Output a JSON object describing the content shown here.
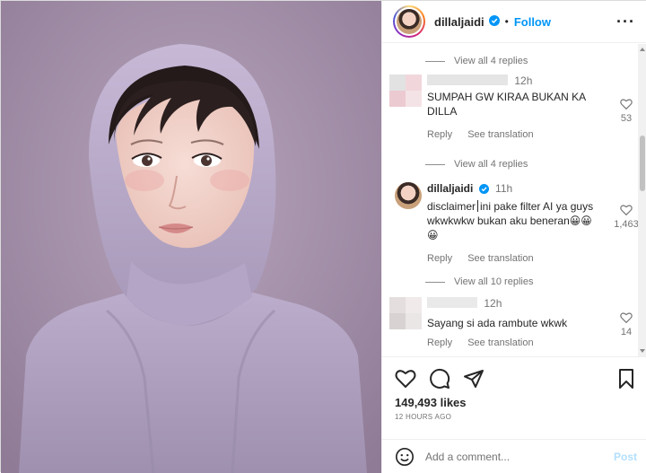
{
  "header": {
    "username": "dillaljaidi",
    "separator": "•",
    "follow_label": "Follow",
    "more_label": "···"
  },
  "comments": {
    "view_replies_1": "View all 4 replies",
    "comment_1": {
      "time": "12h",
      "text": "SUMPAH GW KIRAA BUKAN KA DILLA",
      "likes": "53",
      "reply": "Reply",
      "translate": "See translation"
    },
    "view_replies_2": "View all 4 replies",
    "comment_2": {
      "username": "dillaljaidi",
      "time": "11h",
      "text_before": "disclaimer",
      "text_after": "ini pake filter AI ya guys wkwkwkw bukan aku beneran😀😀😀",
      "likes": "1,463",
      "reply": "Reply",
      "translate": "See translation"
    },
    "view_replies_3": "View all 10 replies",
    "comment_3": {
      "time": "12h",
      "text": "Sayang si ada rambute wkwk",
      "likes": "14",
      "reply": "Reply",
      "translate": "See translation"
    }
  },
  "actions": {
    "like_icon": "heart-outline",
    "comment_icon": "comment-bubble",
    "share_icon": "paper-plane",
    "save_icon": "bookmark",
    "likes_text": "149,493 likes",
    "time_ago": "12 HOURS AGO"
  },
  "composer": {
    "emoji_icon": "smiley",
    "placeholder": "Add a comment...",
    "post_label": "Post"
  },
  "colors": {
    "accent": "#0095f6",
    "post_disabled": "#b2dffc",
    "photo_background": "#a996ad"
  }
}
